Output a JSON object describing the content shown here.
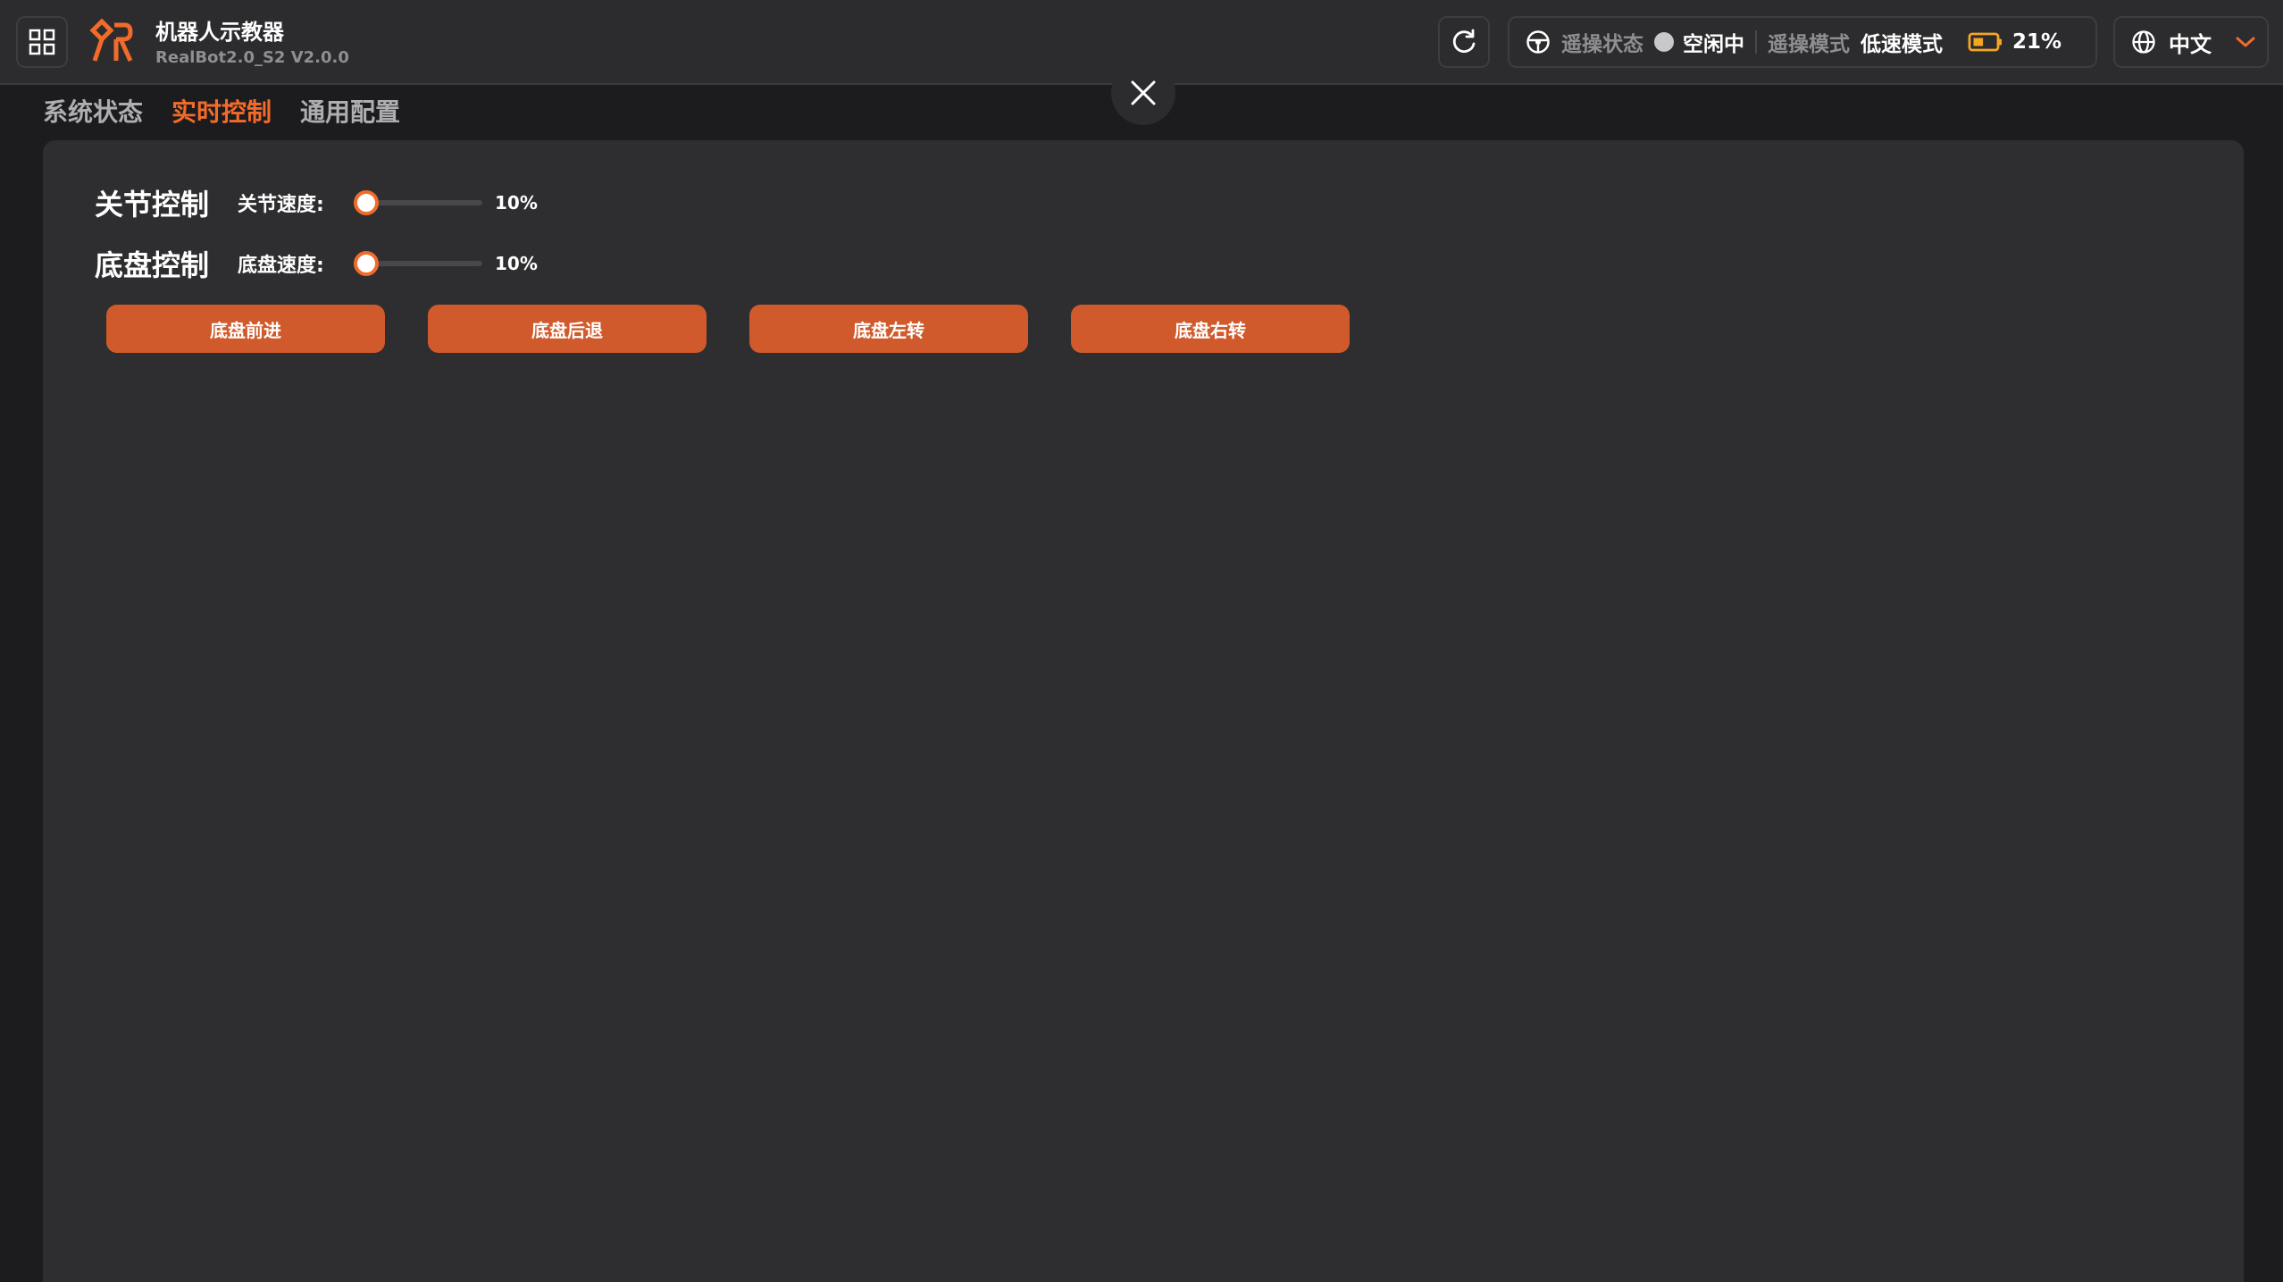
{
  "app": {
    "title": "机器人示教器",
    "version": "RealBot2.0_S2 V2.0.0"
  },
  "status": {
    "teleop_state_label": "遥操状态",
    "teleop_state_value": "空闲中",
    "teleop_mode_label": "遥操模式",
    "teleop_mode_value": "低速模式",
    "battery_percent": "21%",
    "battery_level": 0.21
  },
  "language": {
    "selected": "中文"
  },
  "tabs": [
    {
      "label": "系统状态",
      "active": false
    },
    {
      "label": "实时控制",
      "active": true
    },
    {
      "label": "通用配置",
      "active": false
    }
  ],
  "joint_control": {
    "title": "关节控制",
    "speed_label": "关节速度:",
    "speed_value": "10%",
    "speed_fraction": 0.1
  },
  "chassis_control": {
    "title": "底盘控制",
    "speed_label": "底盘速度:",
    "speed_value": "10%",
    "speed_fraction": 0.1
  },
  "chassis_buttons": [
    {
      "label": "底盘前进"
    },
    {
      "label": "底盘后退"
    },
    {
      "label": "底盘左转"
    },
    {
      "label": "底盘右转"
    }
  ],
  "colors": {
    "accent": "#f26b2a",
    "button": "#d05a2b",
    "battery": "#f5a623",
    "panel": "#2e2e30"
  },
  "icons": {
    "apps": "grid-icon",
    "logo": "robot-logo-icon",
    "refresh": "refresh-icon",
    "teleop": "steering-wheel-icon",
    "battery": "battery-icon",
    "language": "globe-icon",
    "dropdown": "chevron-down-icon",
    "close": "close-icon"
  }
}
